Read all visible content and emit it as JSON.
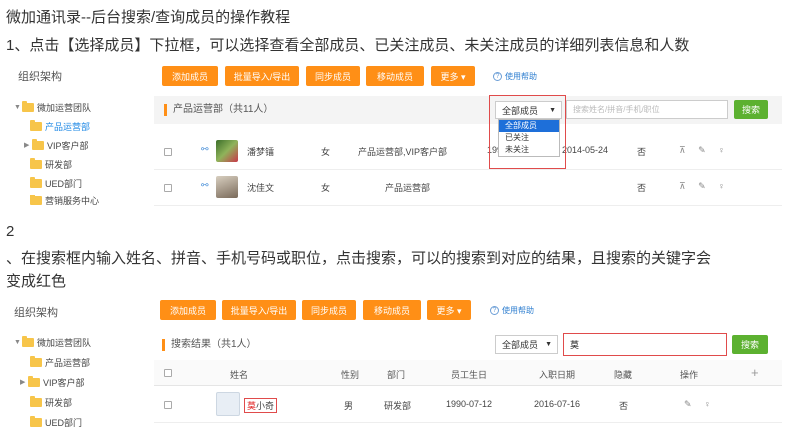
{
  "doc": {
    "title": "微加通讯录--后台搜索/查询成员的操作教程",
    "step1": "1、点击【选择成员】下拉框，可以选择查看全部成员、已关注成员、未关注成员的详细列表信息和人数",
    "step2_num": "2",
    "step2_line1": "、在搜索框内输入姓名、拼音、手机号码或职位，点击搜索，可以的搜索到对应的结果，且搜索的关键字会",
    "step2_line2": "变成红色"
  },
  "panel1": {
    "sidebar_title": "组织架构",
    "tree": [
      {
        "label": "微加运营团队",
        "arrow": "▼"
      },
      {
        "label": "产品运营部",
        "arrow": ""
      },
      {
        "label": "VIP客户部",
        "arrow": "▶"
      },
      {
        "label": "研发部",
        "arrow": ""
      },
      {
        "label": "UED部门",
        "arrow": ""
      },
      {
        "label": "营销服务中心",
        "arrow": ""
      }
    ],
    "toolbar": [
      "添加成员",
      "批量导入/导出",
      "同步成员",
      "移动成员",
      "更多 ▾"
    ],
    "help": "使用帮助",
    "section_title": "产品运营部（共11人）",
    "select_value": "全部成员",
    "select_arrow": "▼",
    "search_placeholder": "搜索姓名/拼音/手机/职位",
    "search_button": "搜索",
    "dropdown_options": [
      "全部成员",
      "已关注",
      "未关注"
    ],
    "rows": [
      {
        "name": "潘梦镭",
        "gender": "女",
        "dept": "产品运营部,VIP客户部",
        "birthday": "1990-",
        "join_date": "2014-05-24",
        "hidden": "否",
        "ops": "⊼ ✎ ♀"
      },
      {
        "name": "沈佳文",
        "gender": "女",
        "dept": "产品运营部",
        "birthday": "",
        "join_date": "",
        "hidden": "否",
        "ops": "⊼ ✎ ♀"
      }
    ]
  },
  "panel2": {
    "sidebar_title": "组织架构",
    "tree": [
      {
        "label": "微加运营团队",
        "arrow": "▼"
      },
      {
        "label": "产品运营部",
        "arrow": ""
      },
      {
        "label": "VIP客户部",
        "arrow": "▶"
      },
      {
        "label": "研发部",
        "arrow": ""
      },
      {
        "label": "UED部门",
        "arrow": ""
      }
    ],
    "toolbar": [
      "添加成员",
      "批量导入/导出",
      "同步成员",
      "移动成员",
      "更多 ▾"
    ],
    "help": "使用帮助",
    "section_title": "搜索结果（共1人）",
    "select_value": "全部成员",
    "select_arrow": "▼",
    "search_value": "莫",
    "search_button": "搜索",
    "columns": [
      "姓名",
      "性别",
      "部门",
      "员工生日",
      "入职日期",
      "隐藏",
      "操作",
      "+"
    ],
    "row": {
      "name_hl": "莫",
      "name_rest": "小奇",
      "gender": "男",
      "dept": "研发部",
      "birthday": "1990-07-12",
      "join_date": "2016-07-16",
      "hidden": "否",
      "ops": "✎ ♀"
    }
  },
  "colors": {
    "accent_orange": "#ff8f16",
    "search_green": "#5cb130",
    "highlight_red": "#e02020",
    "link_blue": "#1e88e5"
  }
}
